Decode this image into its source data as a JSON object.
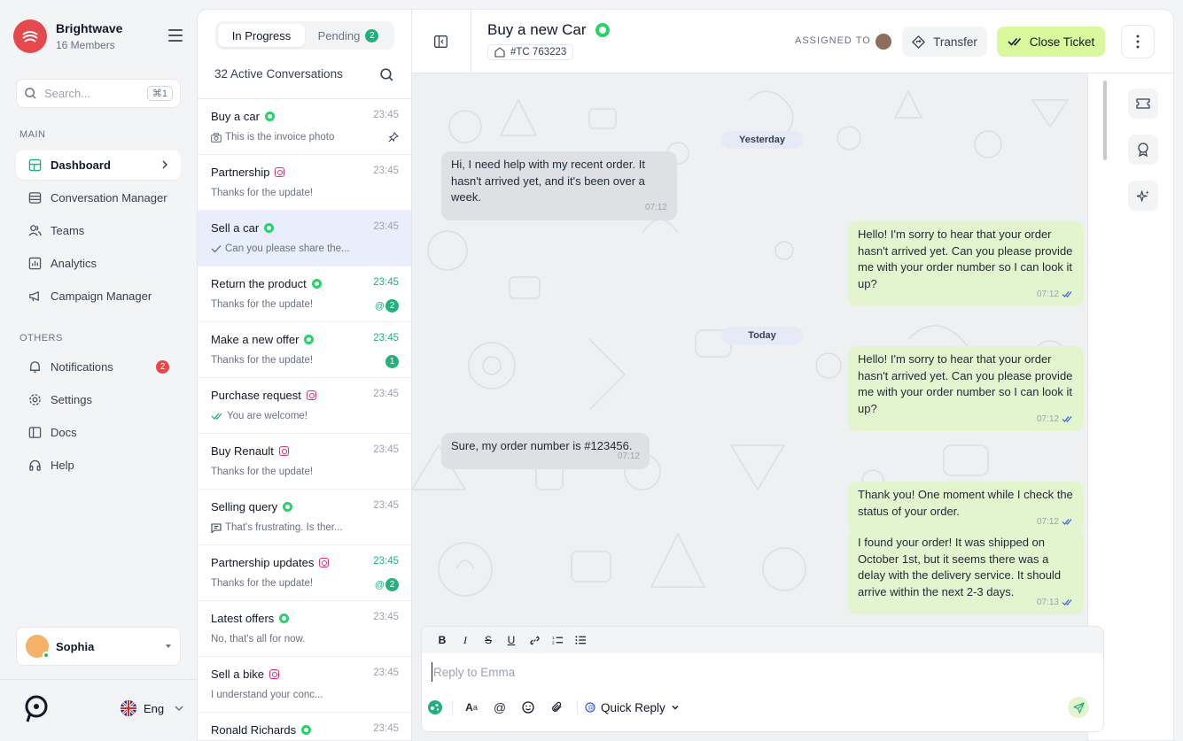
{
  "brand": {
    "name": "Brightwave",
    "members": "16 Members"
  },
  "search": {
    "placeholder": "Search...",
    "shortcut": "⌘1"
  },
  "sections": {
    "main": "MAIN",
    "others": "OTHERS"
  },
  "nav_main": [
    {
      "label": "Dashboard",
      "icon": "dashboard-icon",
      "active": true
    },
    {
      "label": "Conversation Manager",
      "icon": "inbox-icon"
    },
    {
      "label": "Teams",
      "icon": "users-icon"
    },
    {
      "label": "Analytics",
      "icon": "chart-icon"
    },
    {
      "label": "Campaign Manager",
      "icon": "megaphone-icon"
    }
  ],
  "nav_others": [
    {
      "label": "Notifications",
      "icon": "bell-icon",
      "badge": "2"
    },
    {
      "label": "Settings",
      "icon": "gear-icon"
    },
    {
      "label": "Docs",
      "icon": "book-icon"
    },
    {
      "label": "Help",
      "icon": "headset-icon"
    }
  ],
  "user": {
    "name": "Sophia"
  },
  "language": {
    "label": "Eng"
  },
  "tabs": {
    "in_progress": "In Progress",
    "pending": "Pending",
    "pending_count": "2"
  },
  "active_conversations": "32 Active Conversations",
  "conversations": [
    {
      "title": "Buy a car",
      "channel": "whatsapp",
      "time": "23:45",
      "preview": "This is the invoice photo",
      "preview_icon": "camera-icon",
      "pinned": true
    },
    {
      "title": "Partnership",
      "channel": "instagram",
      "time": "23:45",
      "preview": "Thanks for the update!"
    },
    {
      "title": "Sell a car",
      "channel": "whatsapp",
      "time": "23:45",
      "preview": "Can you please share the...",
      "preview_icon": "check-icon",
      "selected": true
    },
    {
      "title": "Return the product",
      "channel": "whatsapp",
      "time": "23:45",
      "time_green": true,
      "preview": "Thanks for the update!",
      "mention": true,
      "unread": "2"
    },
    {
      "title": "Make a new offer",
      "channel": "whatsapp",
      "time": "23:45",
      "time_green": true,
      "preview": "Thanks for the update!",
      "unread": "1"
    },
    {
      "title": "Purchase request",
      "channel": "instagram",
      "time": "23:45",
      "preview": "You are welcome!",
      "preview_icon": "double-check-icon"
    },
    {
      "title": "Buy Renault",
      "channel": "instagram",
      "time": "23:45",
      "preview": "Thanks for the update!"
    },
    {
      "title": "Selling query",
      "channel": "whatsapp",
      "time": "23:45",
      "preview": "That's frustrating. Is ther...",
      "preview_icon": "message-icon"
    },
    {
      "title": "Partnership updates",
      "channel": "instagram",
      "time": "23:45",
      "time_green": true,
      "preview": "Thanks for the update!",
      "mention": true,
      "unread": "2"
    },
    {
      "title": "Latest offers",
      "channel": "whatsapp",
      "time": "23:45",
      "preview": "No, that's all for now."
    },
    {
      "title": "Sell a bike",
      "channel": "instagram",
      "time": "23:45",
      "preview": "I understand your conc..."
    },
    {
      "title": "Ronald Richards",
      "channel": "whatsapp",
      "time": "23:45",
      "preview": ""
    }
  ],
  "chat": {
    "title": "Buy a new Car",
    "ticket": "#TC 763223",
    "assigned_label": "ASSIGNED TO",
    "transfer": "Transfer",
    "close_ticket": "Close Ticket"
  },
  "days": {
    "yesterday": "Yesterday",
    "today": "Today"
  },
  "messages": [
    {
      "dir": "in",
      "text": "Hi, I need help with my recent order. It hasn't arrived yet, and it's been over a week.",
      "time": "07:12"
    },
    {
      "dir": "out",
      "text": "Hello! I'm sorry to hear that your order hasn't arrived yet. Can you please provide me with your order number so I can look it up?",
      "time": "07:12"
    },
    {
      "dir": "out",
      "text": "Hello! I'm sorry to hear that your order hasn't arrived yet. Can you please provide me with your order number so I can look it up?",
      "time": "07:12"
    },
    {
      "dir": "in",
      "text": "Sure, my order number is #123456.",
      "time": "07:12"
    },
    {
      "dir": "out",
      "text": "Thank you! One moment while I check the status of your order.",
      "time": "07:12"
    },
    {
      "dir": "out",
      "text": "I found your order! It was shipped on October 1st, but it seems there was a delay with the delivery service. It should arrive within the next 2-3 days.",
      "time": "07:13"
    }
  ],
  "composer": {
    "placeholder": "Reply to Emma",
    "quick_reply": "Quick Reply"
  },
  "colors": {
    "accent": "#22b07d",
    "brand": "#e5484d",
    "close": "#d9f99d",
    "out_bubble": "#e2f5cf",
    "in_bubble": "#dfe0e3"
  }
}
